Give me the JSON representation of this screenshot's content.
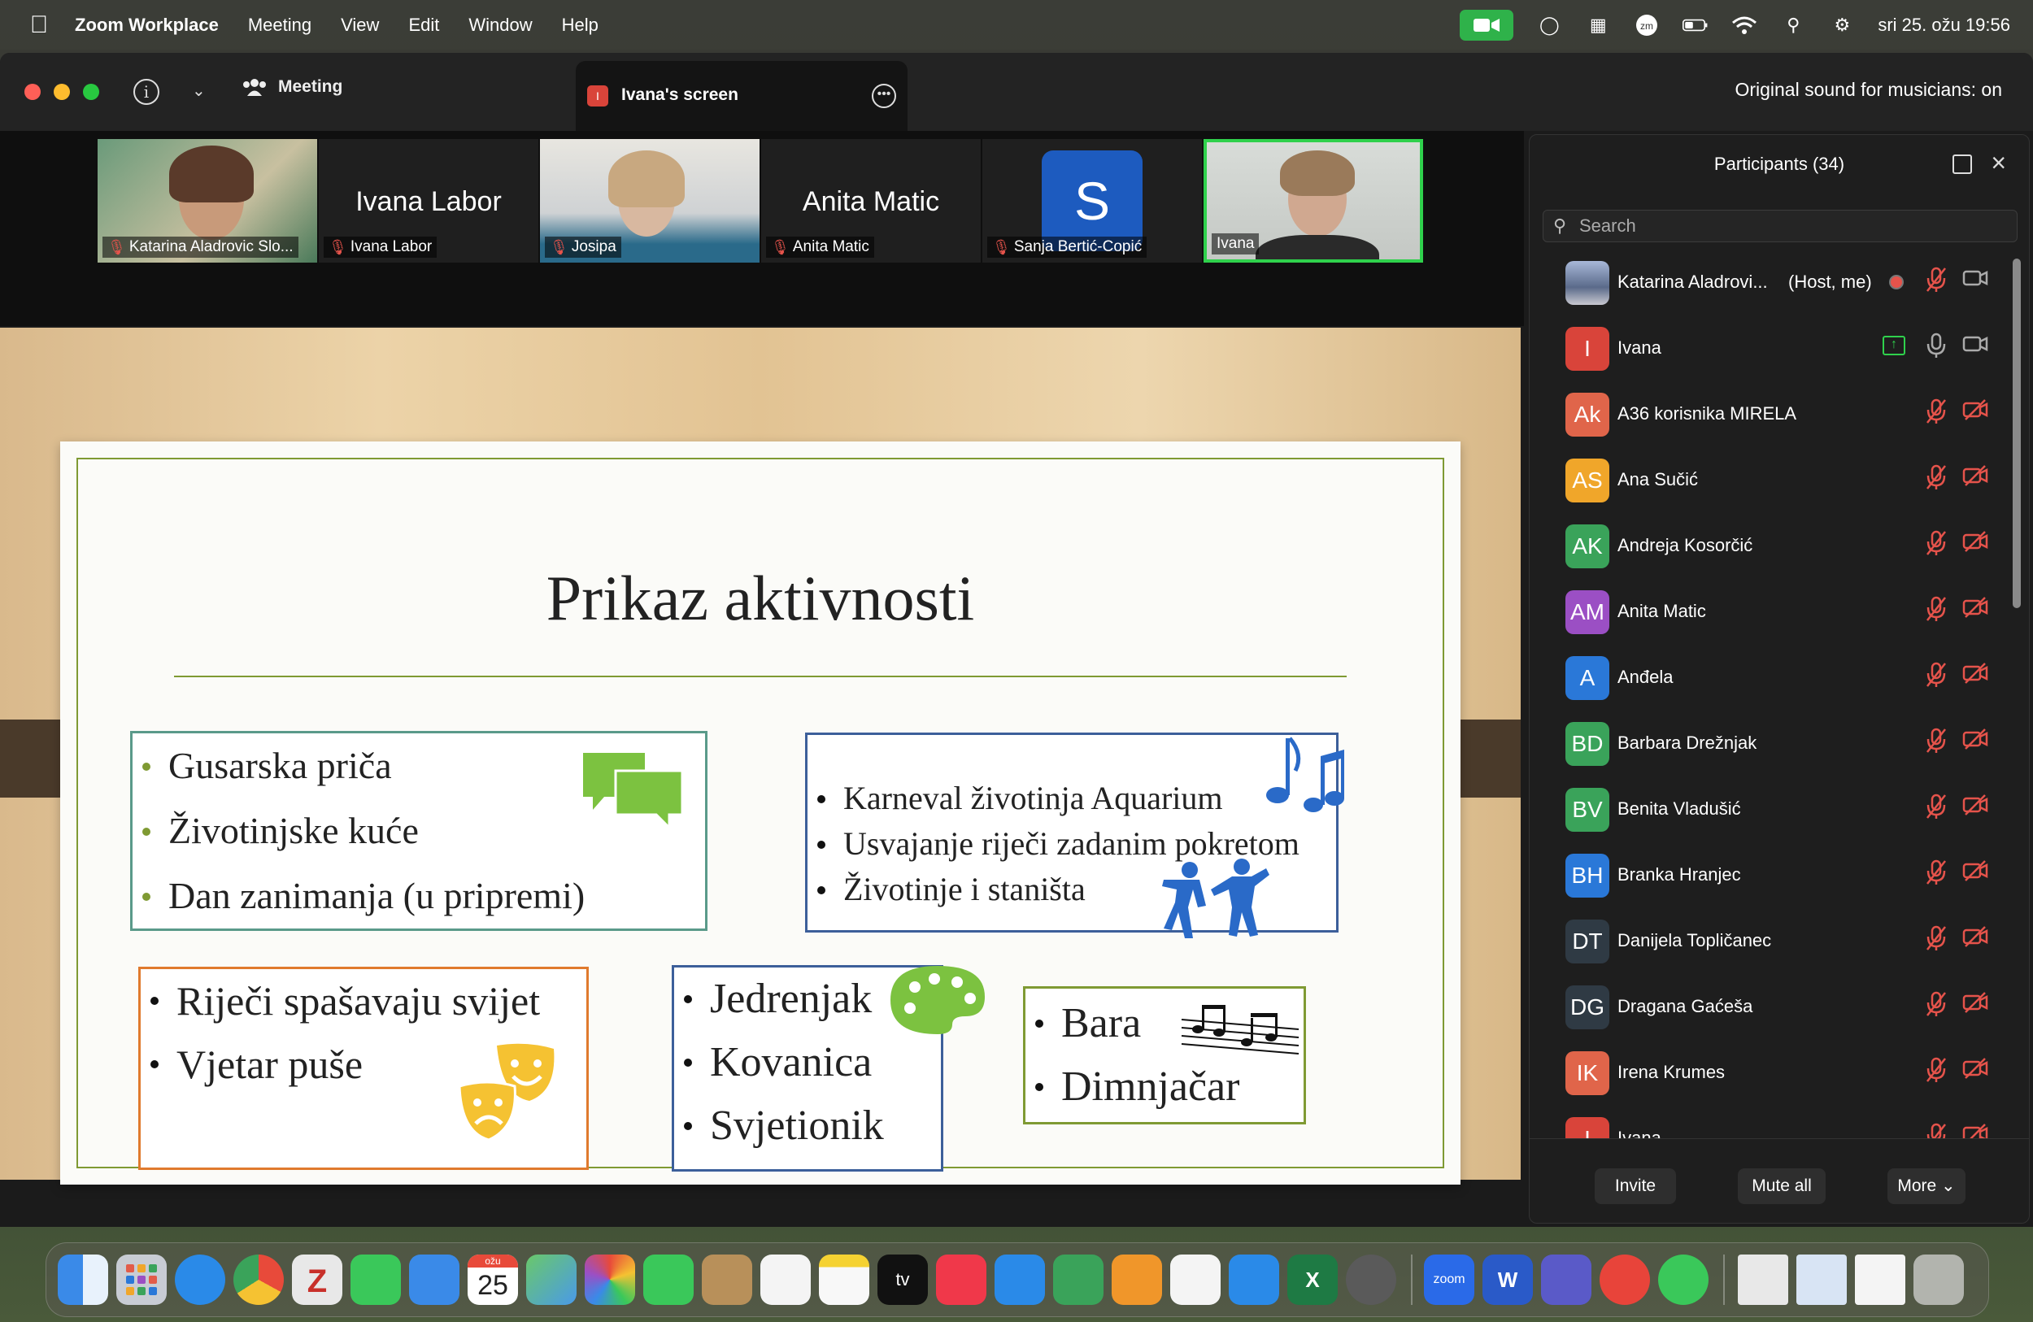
{
  "menubar": {
    "app": "Zoom Workplace",
    "items": [
      "Meeting",
      "View",
      "Edit",
      "Window",
      "Help"
    ],
    "clock": "sri 25. ožu  19:56"
  },
  "titlebar": {
    "meeting_label": "Meeting",
    "tab_title": "Ivana's screen",
    "tab_badge": "I",
    "sound_status": "Original sound for musicians: on"
  },
  "thumbs": [
    {
      "label": "Katarina Aladrovic Slo...",
      "muted": true,
      "type": "video"
    },
    {
      "label": "Ivana Labor",
      "big": "Ivana Labor",
      "muted": true,
      "type": "name"
    },
    {
      "label": "Josipa",
      "muted": true,
      "type": "video"
    },
    {
      "label": "Anita Matic",
      "big": "Anita Matic",
      "muted": true,
      "type": "name"
    },
    {
      "label": "Sanja Bertić-Copić",
      "initial": "S",
      "muted": true,
      "type": "avatar"
    },
    {
      "label": "Ivana",
      "muted": false,
      "type": "video",
      "active": true
    }
  ],
  "slide": {
    "title": "Prikaz aktivnosti",
    "box1": [
      "Gusarska priča",
      "Životinjske kuće",
      "Dan zanimanja (u pripremi)"
    ],
    "box2": [
      "Karneval životinja Aquarium",
      "Usvajanje riječi zadanim pokretom",
      "Životinje i staništa"
    ],
    "box3": [
      "Riječi spašavaju svijet",
      "Vjetar puše"
    ],
    "box4": [
      "Jedrenjak",
      "Kovanica",
      "Svjetionik"
    ],
    "box5": [
      "Bara",
      "Dimnjačar"
    ]
  },
  "participants": {
    "title": "Participants (34)",
    "search_placeholder": "Search",
    "list": [
      {
        "initials": "",
        "name": "Katarina Aladrovi...",
        "tag": "(Host, me)",
        "color": "#6a7aa0",
        "photo": true,
        "mic": "muted",
        "video": "on",
        "recording": true
      },
      {
        "initials": "I",
        "name": "Ivana",
        "color": "#d9443a",
        "mic": "on",
        "video": "on",
        "sharing": true
      },
      {
        "initials": "Ak",
        "name": "A36 korisnika MIRELA",
        "color": "#e0654a",
        "mic": "muted",
        "video": "off"
      },
      {
        "initials": "AS",
        "name": "Ana Sučić",
        "color": "#f0a62a",
        "mic": "muted",
        "video": "off"
      },
      {
        "initials": "AK",
        "name": "Andreja Kosorčić",
        "color": "#3aa35a",
        "mic": "muted",
        "video": "off"
      },
      {
        "initials": "AM",
        "name": "Anita Matic",
        "color": "#9b4fc4",
        "mic": "muted",
        "video": "off"
      },
      {
        "initials": "A",
        "name": "Anđela",
        "color": "#2a78d8",
        "mic": "muted",
        "video": "off"
      },
      {
        "initials": "BD",
        "name": "Barbara Drežnjak",
        "color": "#3aa35a",
        "mic": "muted",
        "video": "off"
      },
      {
        "initials": "BV",
        "name": "Benita Vladušić",
        "color": "#3aa35a",
        "mic": "muted",
        "video": "off"
      },
      {
        "initials": "BH",
        "name": "Branka Hranjec",
        "color": "#2a78d8",
        "mic": "muted",
        "video": "off"
      },
      {
        "initials": "DT",
        "name": "Danijela Topličanec",
        "color": "#2f3a44",
        "mic": "muted",
        "video": "off"
      },
      {
        "initials": "DG",
        "name": "Dragana Gaćeša",
        "color": "#2f3a44",
        "mic": "muted",
        "video": "off"
      },
      {
        "initials": "IK",
        "name": "Irena Krumes",
        "color": "#e0654a",
        "mic": "muted",
        "video": "off"
      },
      {
        "initials": "I",
        "name": "Ivana",
        "color": "#d9443a",
        "mic": "muted",
        "video": "off"
      }
    ],
    "footer": {
      "invite": "Invite",
      "mute_all": "Mute all",
      "more": "More"
    }
  },
  "dock": {
    "calendar_month": "ožu",
    "calendar_day": "25",
    "tv_label": "tv",
    "zoom_label": "zoom",
    "word_label": "W",
    "excel_label": "X"
  },
  "colors": {
    "accent_green": "#2fd14c",
    "zoom_green": "#2fb24a",
    "muted_red": "#e5534b",
    "slide_green": "#7f9a33"
  }
}
